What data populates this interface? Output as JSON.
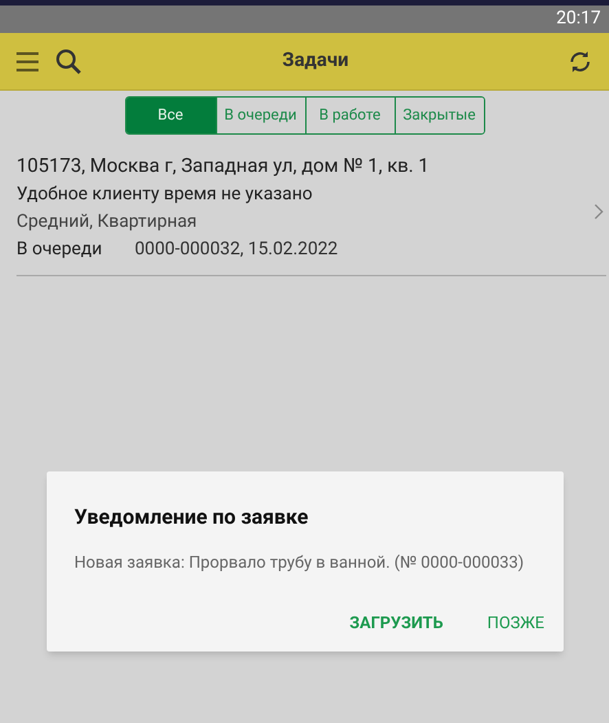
{
  "status_bar": {
    "time": "20:17"
  },
  "app_bar": {
    "title": "Задачи"
  },
  "tabs": [
    {
      "label": "Все",
      "selected": true
    },
    {
      "label": "В очереди",
      "selected": false
    },
    {
      "label": "В работе",
      "selected": false
    },
    {
      "label": "Закрытые",
      "selected": false
    }
  ],
  "tasks": [
    {
      "address": "105173, Москва г, Западная ул, дом № 1, кв. 1",
      "time_note": "Удобное клиенту время не указано",
      "details": "Средний, Квартирная",
      "status": "В очереди",
      "number_date": "0000-000032, 15.02.2022"
    }
  ],
  "dialog": {
    "title": "Уведомление по заявке",
    "message": "Новая заявка: Прорвало трубу в ванной. (№ 0000-000033)",
    "buttons": [
      "ЗАГРУЗИТЬ",
      "ПОЗЖЕ"
    ]
  }
}
